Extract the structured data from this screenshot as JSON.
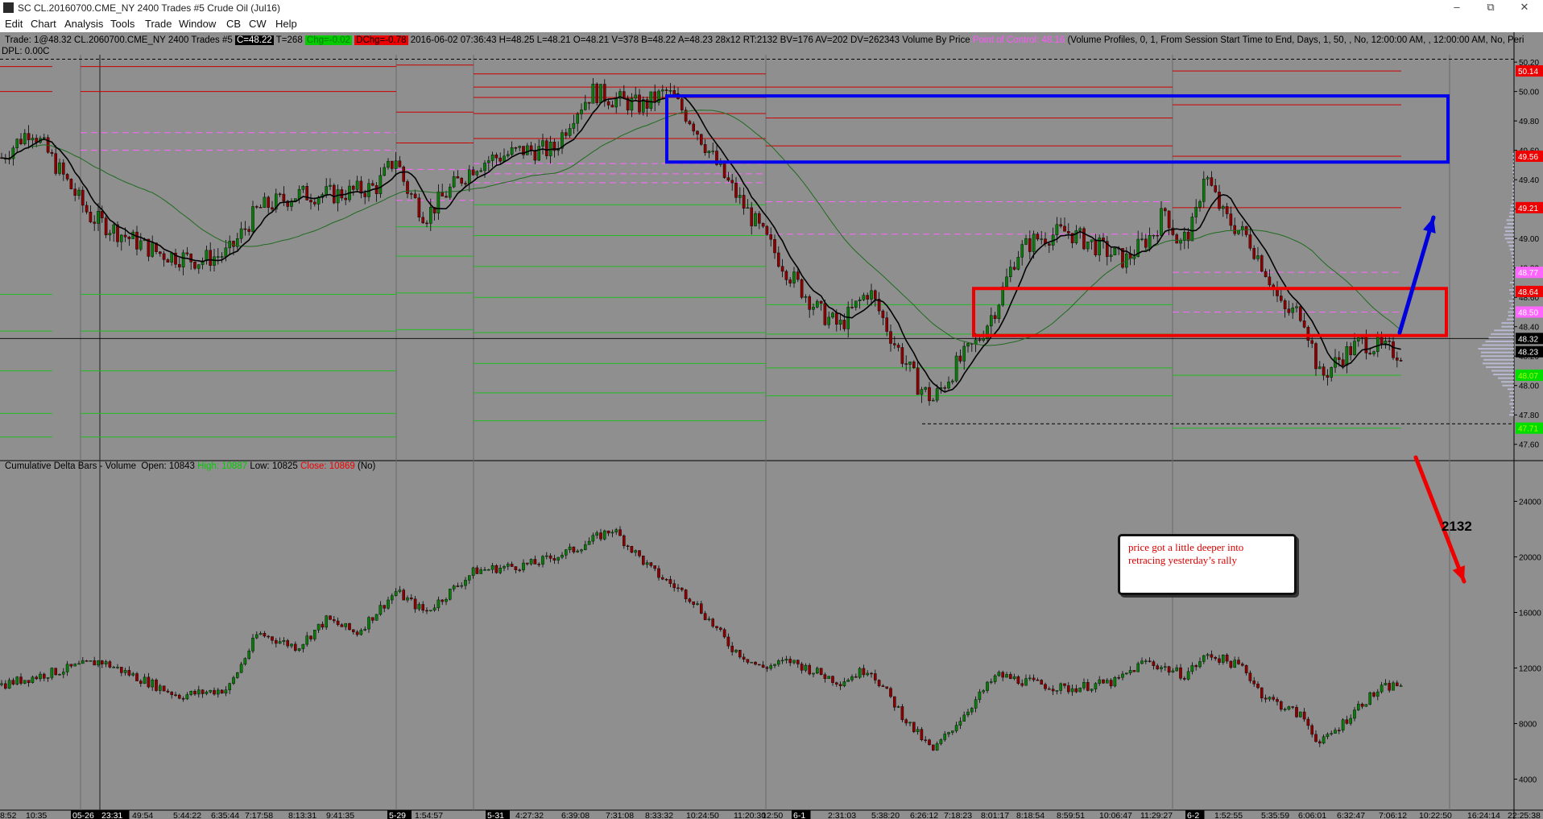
{
  "window": {
    "title": "SC CL.20160700.CME_NY  2400 Trades  #5  Crude Oil (Jul16)"
  },
  "menu": [
    "Edit",
    "Chart",
    "Analysis",
    "Tools",
    "Trade",
    "Window",
    "CB",
    "CW",
    "Help"
  ],
  "header": {
    "trade_label": "Trade: 1@48.32  CL.20",
    "symbol_rest": "60700.CME_NY  2400 Trades  #5",
    "close_box": "C=48.22",
    "tick_count": "T=268",
    "chg_box": "Chg=-0.02",
    "dchg_box": "DChg=-0.78",
    "stats": "2016-06-02 07:36:43 H=48.25 L=48.21 O=48.21 V=378 B=48.22 A=48.23 28x12 RT:2132 BV=176 AV=202 DV=262343 Volume By Price",
    "poc_text": "Point of Control: 48.16",
    "profile_text": "(Volume Profiles, 0, 1, From Session Start Time to End, Days, 1, 50, , No, 12:00:00 AM, , 12:00:00 AM, No, Peri",
    "dpl": "DPL: 0.00C"
  },
  "lower_header": {
    "name": "Cumulative Delta Bars - Volume",
    "open_label": "Open: 10843",
    "high_label": "High: 10887",
    "low_label": "Low: 10825",
    "close_label": "Close: 10869",
    "tail": "(No)"
  },
  "annotation": {
    "text_line1": "price got a little deeper into",
    "text_line2": "retracing yesterday’s rally",
    "label_2132": "2132"
  },
  "colors": {
    "background": "#8f8f8f",
    "up_bar": "#0a7a0a",
    "down_bar": "#8b0000",
    "resistance": "#cc0000",
    "support": "#22bb22",
    "value_area": "#ff66ff",
    "blue_box": "#0000ee",
    "red_box": "#ee0000"
  },
  "chart_data": [
    {
      "type": "candlestick",
      "title": "Crude Oil (Jul16)",
      "ylim": [
        47.5,
        50.25
      ],
      "y_ticks": [
        "50.20",
        "50.00",
        "49.80",
        "49.60",
        "49.40",
        "49.20",
        "49.00",
        "48.80",
        "48.60",
        "48.40",
        "48.20",
        "48.00",
        "47.80",
        "47.60"
      ],
      "x_ticks": [
        "8:52",
        "10:35",
        "05-26",
        "23:31",
        "49:54",
        "5:44:22",
        "6:35:44",
        "7:17:58",
        "8:13:31",
        "9:41:35",
        "5-29",
        "1:54:57",
        "5-31",
        "4:27:32",
        "6:39:08",
        "7:31:08",
        "8:33:32",
        "10:24:50",
        "11:20:30",
        "12:50",
        "6-1",
        "2:31:03",
        "5:38:20",
        "6:26:12",
        "7:18:23",
        "8:01:17",
        "8:18:54",
        "8:59:51",
        "10:06:47",
        "11:29:27",
        "6-2",
        "1:52:55",
        "5:35:59",
        "6:06:01",
        "6:32:47",
        "7:06:12",
        "10:22:50",
        "16:24:14",
        "22:25:38"
      ],
      "price_path_knots": [
        [
          0,
          49.55
        ],
        [
          30,
          49.75
        ],
        [
          60,
          49.45
        ],
        [
          90,
          49.15
        ],
        [
          130,
          49.0
        ],
        [
          160,
          48.9
        ],
        [
          200,
          48.85
        ],
        [
          230,
          48.9
        ],
        [
          260,
          49.2
        ],
        [
          300,
          49.3
        ],
        [
          340,
          49.3
        ],
        [
          380,
          49.35
        ],
        [
          400,
          49.55
        ],
        [
          410,
          49.35
        ],
        [
          430,
          49.15
        ],
        [
          450,
          49.3
        ],
        [
          480,
          49.5
        ],
        [
          500,
          49.55
        ],
        [
          530,
          49.6
        ],
        [
          560,
          49.6
        ],
        [
          580,
          49.85
        ],
        [
          600,
          50.0
        ],
        [
          620,
          49.95
        ],
        [
          650,
          49.9
        ],
        [
          675,
          50.0
        ],
        [
          700,
          49.8
        ],
        [
          730,
          49.45
        ],
        [
          760,
          49.15
        ],
        [
          780,
          48.95
        ],
        [
          800,
          48.75
        ],
        [
          830,
          48.5
        ],
        [
          850,
          48.4
        ],
        [
          880,
          48.65
        ],
        [
          905,
          48.3
        ],
        [
          930,
          48.0
        ],
        [
          945,
          47.9
        ],
        [
          970,
          48.15
        ],
        [
          990,
          48.3
        ],
        [
          1010,
          48.55
        ],
        [
          1030,
          48.9
        ],
        [
          1050,
          49.0
        ],
        [
          1080,
          49.05
        ],
        [
          1110,
          48.95
        ],
        [
          1140,
          48.85
        ],
        [
          1170,
          49.05
        ],
        [
          1180,
          49.2
        ],
        [
          1195,
          48.95
        ],
        [
          1210,
          49.1
        ],
        [
          1220,
          49.45
        ],
        [
          1240,
          49.15
        ],
        [
          1265,
          49.0
        ],
        [
          1285,
          48.75
        ],
        [
          1300,
          48.5
        ],
        [
          1320,
          48.5
        ],
        [
          1338,
          48.05
        ],
        [
          1360,
          48.2
        ],
        [
          1380,
          48.3
        ],
        [
          1400,
          48.25
        ],
        [
          1420,
          48.22
        ]
      ],
      "last_prices": [
        "48.32",
        "48.23"
      ],
      "right_labels": [
        {
          "value": "50.14",
          "color": "red"
        },
        {
          "value": "49.56",
          "color": "red"
        },
        {
          "value": "49.21",
          "color": "red"
        },
        {
          "value": "48.77",
          "color": "magenta"
        },
        {
          "value": "48.64",
          "color": "red"
        },
        {
          "value": "48.50",
          "color": "magenta"
        },
        {
          "value": "48.32",
          "color": "black"
        },
        {
          "value": "48.23",
          "color": "black"
        },
        {
          "value": "48.07",
          "color": "green"
        },
        {
          "value": "47.71",
          "color": "green"
        }
      ],
      "session_levels": [
        {
          "session": "05-26",
          "resistance": [
            50.17,
            50.0
          ],
          "value_area": [
            49.72,
            49.6
          ],
          "support": [
            48.62,
            48.37,
            48.1,
            47.81,
            47.65
          ]
        },
        {
          "session": "5-29",
          "resistance": [
            50.18,
            49.86,
            49.65
          ],
          "value_area": [
            49.47,
            49.26
          ],
          "support": [
            49.08,
            48.88,
            48.63,
            48.38
          ]
        },
        {
          "session": "5-31",
          "resistance": [
            50.12,
            50.03,
            49.96,
            49.85,
            49.68
          ],
          "value_area": [
            49.51,
            49.44,
            49.38
          ],
          "support": [
            49.23,
            49.02,
            48.81,
            48.6,
            48.36,
            48.15,
            47.95,
            47.76
          ]
        },
        {
          "session": "6-1",
          "resistance": [
            50.03,
            49.82,
            49.63
          ],
          "value_area": [
            49.25,
            49.03
          ],
          "support": [
            48.55,
            48.35,
            48.12,
            47.93
          ]
        },
        {
          "session": "6-2",
          "resistance": [
            50.14,
            49.91,
            49.56,
            49.21
          ],
          "value_area": [
            48.77,
            48.5
          ],
          "support": [
            48.07,
            47.71
          ]
        }
      ],
      "low_marker": 47.74
    },
    {
      "type": "candlestick",
      "title": "Cumulative Delta Bars - Volume",
      "ylim": [
        2000,
        26000
      ],
      "y_ticks": [
        "24000",
        "20000",
        "16000",
        "12000",
        "8000",
        "4000"
      ],
      "delta_path_knots": [
        [
          0,
          10800
        ],
        [
          100,
          12500
        ],
        [
          180,
          10000
        ],
        [
          230,
          10500
        ],
        [
          260,
          14500
        ],
        [
          300,
          13500
        ],
        [
          330,
          15500
        ],
        [
          360,
          14500
        ],
        [
          400,
          17500
        ],
        [
          430,
          16000
        ],
        [
          480,
          19000
        ],
        [
          540,
          19500
        ],
        [
          580,
          20500
        ],
        [
          620,
          22000
        ],
        [
          660,
          19000
        ],
        [
          700,
          17000
        ],
        [
          740,
          13500
        ],
        [
          770,
          12000
        ],
        [
          800,
          12500
        ],
        [
          850,
          11000
        ],
        [
          880,
          12000
        ],
        [
          920,
          8000
        ],
        [
          945,
          6000
        ],
        [
          980,
          9000
        ],
        [
          1010,
          11500
        ],
        [
          1040,
          11000
        ],
        [
          1080,
          10500
        ],
        [
          1130,
          11000
        ],
        [
          1160,
          12500
        ],
        [
          1200,
          11500
        ],
        [
          1225,
          13000
        ],
        [
          1260,
          12000
        ],
        [
          1280,
          10000
        ],
        [
          1320,
          8500
        ],
        [
          1338,
          6500
        ],
        [
          1360,
          8000
        ],
        [
          1380,
          9500
        ],
        [
          1400,
          10500
        ],
        [
          1420,
          10869
        ]
      ]
    }
  ]
}
